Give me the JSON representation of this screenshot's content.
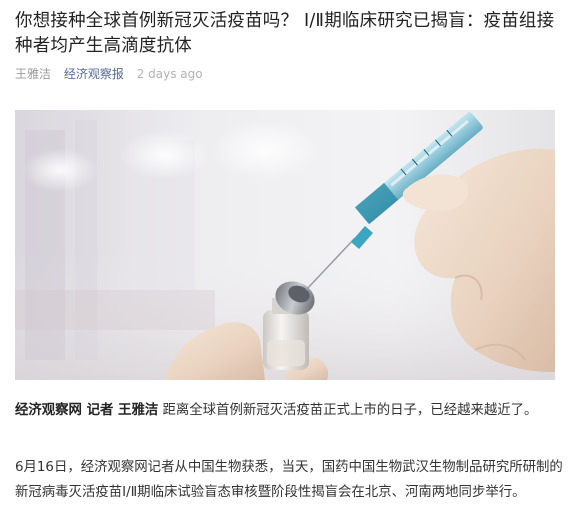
{
  "article": {
    "title": "你想接种全球首例新冠灭活疫苗吗？ Ⅰ/Ⅱ期临床研究已揭盲：疫苗组接种者均产生高滴度抗体",
    "author": "王雅洁",
    "source": "经济观察报",
    "time": "2 days ago"
  },
  "hero_image": {
    "description": "vaccine-syringe-and-vial-photo"
  },
  "body": {
    "p1_lead": "经济观察网 记者 王雅洁",
    "p1_text": " 距离全球首例新冠灭活疫苗正式上市的日子，已经越来越近了。",
    "p2_text": "6月16日，经济观察网记者从中国生物获悉，当天，国药中国生物武汉生物制品研究所研制的新冠病毒灭活疫苗Ⅰ/Ⅱ期临床试验盲态审核暨阶段性揭盲会在北京、河南两地同步举行。"
  },
  "colors": {
    "source_link": "#576b95",
    "meta_gray": "#9a9a9a",
    "text": "#333333"
  }
}
